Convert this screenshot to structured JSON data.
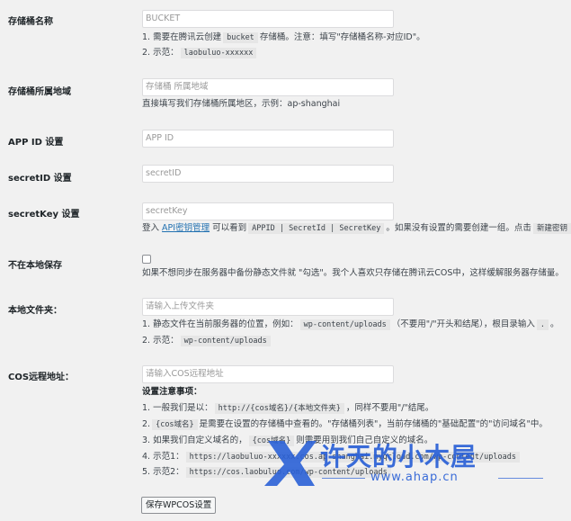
{
  "fields": {
    "bucket": {
      "label": "存储桶名称",
      "placeholder": "BUCKET",
      "desc1_pre": "1. 需要在腾讯云创建",
      "desc1_code": "bucket",
      "desc1_post": "存储桶。注意：填写\"存储桶名称-对应ID\"。",
      "desc2_pre": "2. 示范：",
      "desc2_code": "laobuluo-xxxxxx"
    },
    "region": {
      "label": "存储桶所属地域",
      "placeholder": "存储桶 所属地域",
      "desc": "直接填写我们存储桶所属地区，示例：ap-shanghai"
    },
    "appid": {
      "label": "APP ID 设置",
      "placeholder": "APP ID"
    },
    "secretid": {
      "label": "secretID 设置",
      "placeholder": "secretID"
    },
    "secretkey": {
      "label": "secretKey 设置",
      "placeholder": "secretKey",
      "desc_pre": "登入",
      "desc_link": "API密钥管理",
      "desc_mid": "可以看到",
      "desc_code": "APPID | SecretId | SecretKey",
      "desc_post": "。如果没有设置的需要创建一组。点击",
      "desc_code2": "新建密钥"
    },
    "nolocal": {
      "label": "不在本地保存",
      "desc": "如果不想同步在服务器中备份静态文件就 \"勾选\"。我个人喜欢只存储在腾讯云COS中，这样缓解服务器存储量。"
    },
    "localdir": {
      "label": "本地文件夹：",
      "placeholder": "请输入上传文件夹",
      "desc1_pre": "1. 静态文件在当前服务器的位置，例如：",
      "desc1_code": "wp-content/uploads",
      "desc1_post": "（不要用\"/\"开头和结尾），根目录输入",
      "desc1_code2": ".",
      "desc1_end": "。",
      "desc2_pre": "2. 示范：",
      "desc2_code": "wp-content/uploads"
    },
    "cosurl": {
      "label": "COS远程地址：",
      "placeholder": "请输入COS远程地址",
      "notes_title": "设置注意事项：",
      "note1_pre": "1. 一般我们是以：",
      "note1_code": "http://{cos域名}/{本地文件夹}",
      "note1_post": "，同样不要用\"/\"结尾。",
      "note2_code": "{cos域名}",
      "note2_post": "是需要在设置的存储桶中查看的。\"存储桶列表\"，当前存储桶的\"基础配置\"的\"访问域名\"中。",
      "note3_pre": "3. 如果我们自定义域名的，",
      "note3_code": "{cos域名}",
      "note3_post": "则需要用到我们自己自定义的域名。",
      "note4_pre": "4. 示范1：",
      "note4_code": "https://laobuluo-xxxxxx.cos.ap-shanghai.myqcloud.com/wp-content/uploads",
      "note5_pre": "5. 示范2：",
      "note5_code": "https://cos.laobuluo.com/wp-content/uploads"
    }
  },
  "save_button": "保存WPCOS设置",
  "watermark": {
    "title": "许天的小木屋",
    "url": "www.ahap.cn",
    "color": "#2a60d6"
  }
}
